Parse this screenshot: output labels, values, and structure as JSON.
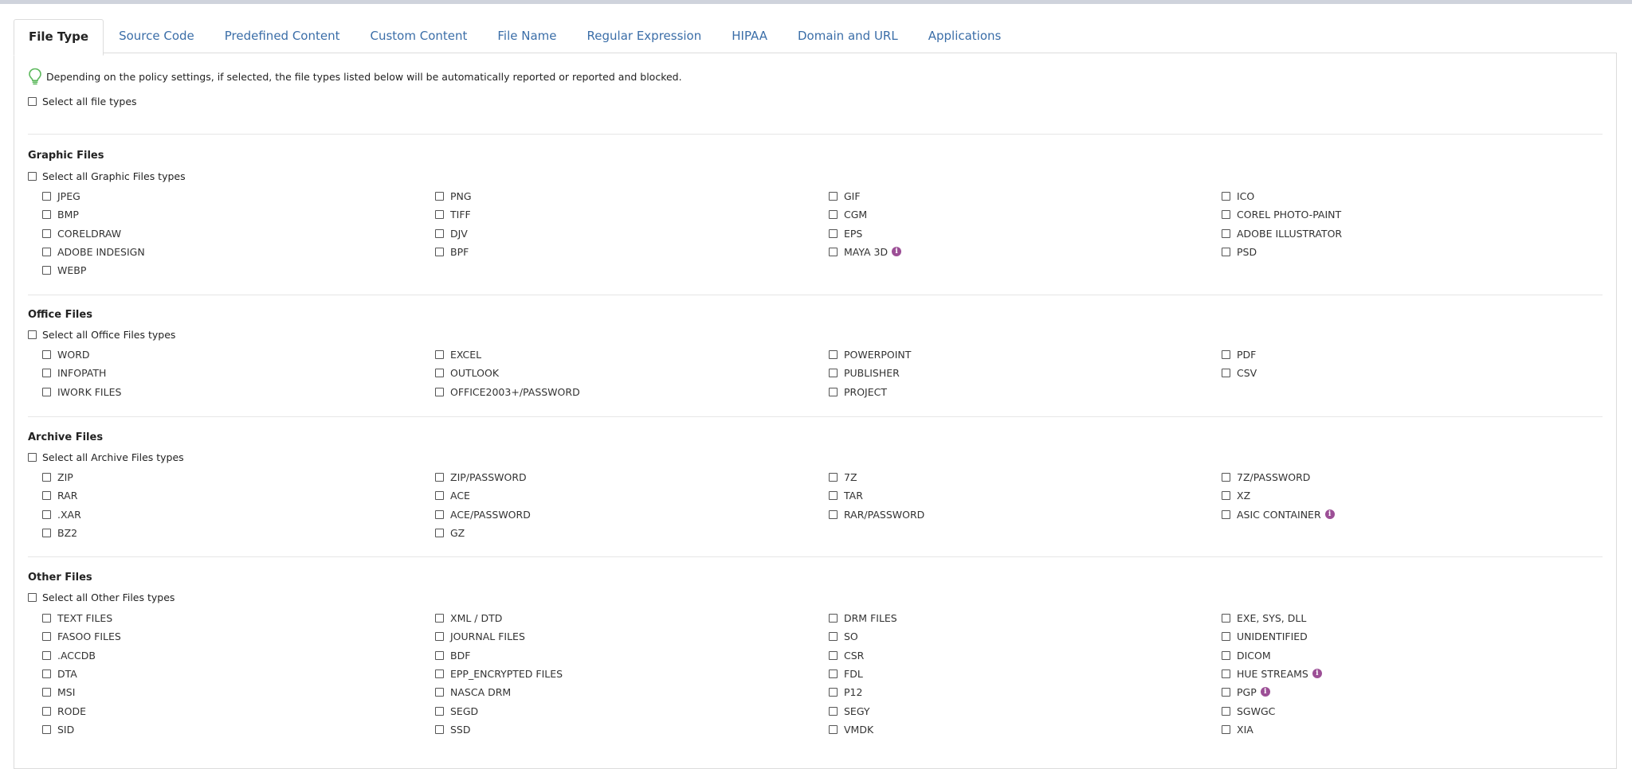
{
  "tabs": [
    {
      "label": "File Type",
      "active": true
    },
    {
      "label": "Source Code"
    },
    {
      "label": "Predefined Content"
    },
    {
      "label": "Custom Content"
    },
    {
      "label": "File Name"
    },
    {
      "label": "Regular Expression"
    },
    {
      "label": "HIPAA"
    },
    {
      "label": "Domain and URL"
    },
    {
      "label": "Applications"
    }
  ],
  "info_text": "Depending on the policy settings, if selected, the file types listed below will be automatically reported or reported and blocked.",
  "select_all_label": "Select all file types",
  "colors": {
    "link": "#3b6ea8",
    "info_icon": "#9c4f96",
    "bulb": "#5cb85c"
  },
  "sections": [
    {
      "title": "Graphic Files",
      "select_all": "Select all Graphic Files types",
      "items": [
        {
          "label": "JPEG"
        },
        {
          "label": "PNG"
        },
        {
          "label": "GIF"
        },
        {
          "label": "ICO"
        },
        {
          "label": "BMP"
        },
        {
          "label": "TIFF"
        },
        {
          "label": "CGM"
        },
        {
          "label": "COREL PHOTO-PAINT"
        },
        {
          "label": "CORELDRAW"
        },
        {
          "label": "DJV"
        },
        {
          "label": "EPS"
        },
        {
          "label": "ADOBE ILLUSTRATOR"
        },
        {
          "label": "ADOBE INDESIGN"
        },
        {
          "label": "BPF"
        },
        {
          "label": "MAYA 3D",
          "info": true
        },
        {
          "label": "PSD"
        },
        {
          "label": "WEBP"
        }
      ]
    },
    {
      "title": "Office Files",
      "select_all": "Select all Office Files types",
      "items": [
        {
          "label": "WORD"
        },
        {
          "label": "EXCEL"
        },
        {
          "label": "POWERPOINT"
        },
        {
          "label": "PDF"
        },
        {
          "label": "INFOPATH"
        },
        {
          "label": "OUTLOOK"
        },
        {
          "label": "PUBLISHER"
        },
        {
          "label": "CSV"
        },
        {
          "label": "IWORK FILES"
        },
        {
          "label": "OFFICE2003+/PASSWORD"
        },
        {
          "label": "PROJECT"
        }
      ]
    },
    {
      "title": "Archive Files",
      "select_all": "Select all Archive Files types",
      "items": [
        {
          "label": "ZIP"
        },
        {
          "label": "ZIP/PASSWORD"
        },
        {
          "label": "7Z"
        },
        {
          "label": "7Z/PASSWORD"
        },
        {
          "label": "RAR"
        },
        {
          "label": "ACE"
        },
        {
          "label": "TAR"
        },
        {
          "label": "XZ"
        },
        {
          "label": ".XAR"
        },
        {
          "label": "ACE/PASSWORD"
        },
        {
          "label": "RAR/PASSWORD"
        },
        {
          "label": "ASIC CONTAINER",
          "info": true
        },
        {
          "label": "BZ2"
        },
        {
          "label": "GZ"
        }
      ]
    },
    {
      "title": "Other Files",
      "select_all": "Select all Other Files types",
      "items": [
        {
          "label": "TEXT FILES"
        },
        {
          "label": "XML / DTD"
        },
        {
          "label": "DRM FILES"
        },
        {
          "label": "EXE, SYS, DLL"
        },
        {
          "label": "FASOO FILES"
        },
        {
          "label": "JOURNAL FILES"
        },
        {
          "label": "SO"
        },
        {
          "label": "UNIDENTIFIED"
        },
        {
          "label": ".ACCDB"
        },
        {
          "label": "BDF"
        },
        {
          "label": "CSR"
        },
        {
          "label": "DICOM"
        },
        {
          "label": "DTA"
        },
        {
          "label": "EPP_ENCRYPTED FILES"
        },
        {
          "label": "FDL"
        },
        {
          "label": "HUE STREAMS",
          "info": true
        },
        {
          "label": "MSI"
        },
        {
          "label": "NASCA DRM"
        },
        {
          "label": "P12"
        },
        {
          "label": "PGP",
          "info": true
        },
        {
          "label": "RODE"
        },
        {
          "label": "SEGD"
        },
        {
          "label": "SEGY"
        },
        {
          "label": "SGWGC"
        },
        {
          "label": "SID"
        },
        {
          "label": "SSD"
        },
        {
          "label": "VMDK"
        },
        {
          "label": "XIA"
        }
      ]
    }
  ]
}
